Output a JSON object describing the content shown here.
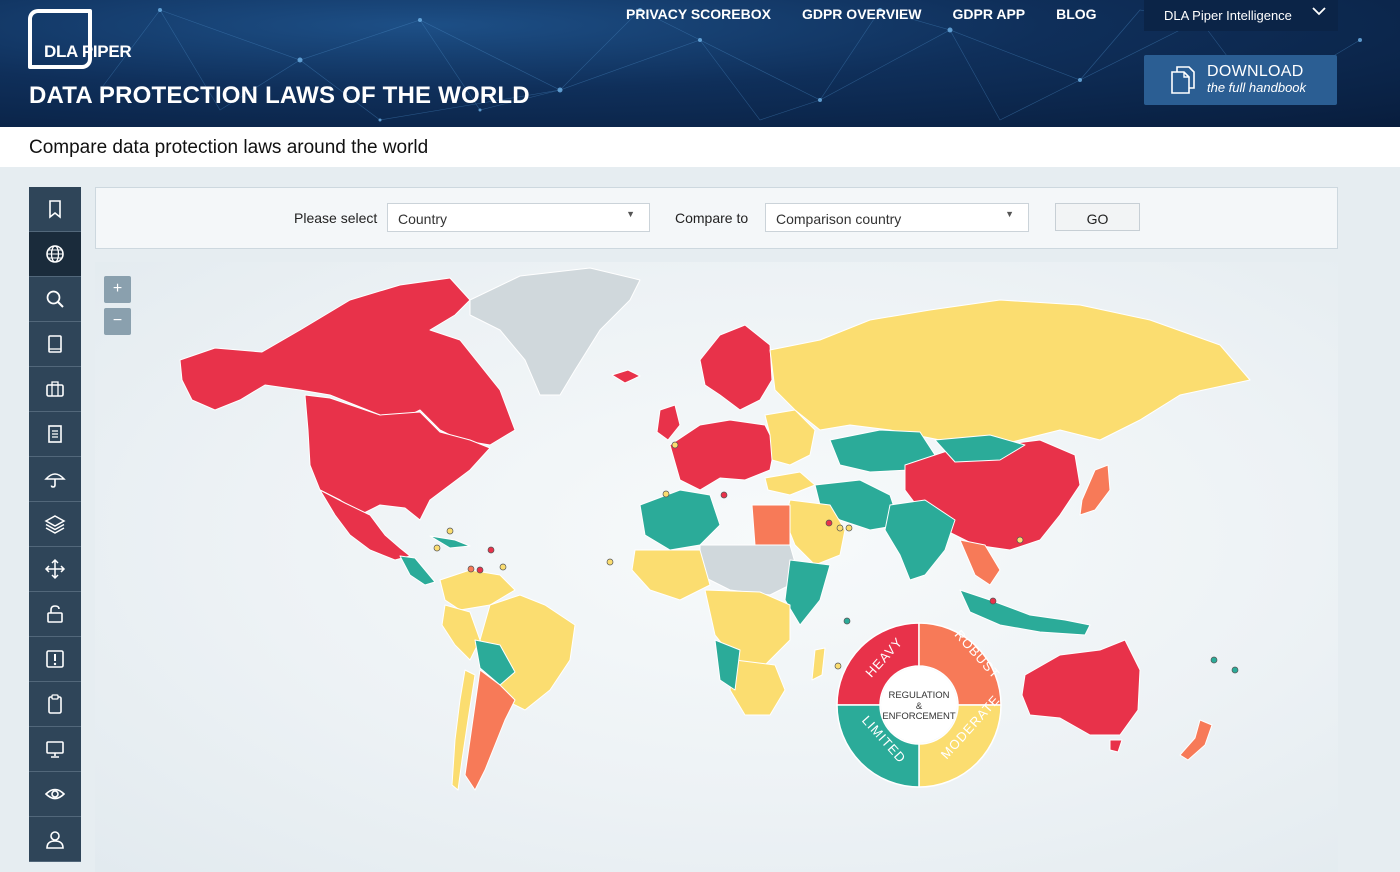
{
  "header": {
    "logo_text": "DLA PIPER",
    "site_title": "DATA PROTECTION LAWS OF THE WORLD",
    "nav": [
      "PRIVACY SCOREBOX",
      "GDPR OVERVIEW",
      "GDPR APP",
      "BLOG"
    ],
    "intelligence_label": "DLA Piper Intelligence",
    "download_main": "DOWNLOAD",
    "download_sub": "the full handbook"
  },
  "subtitle": "Compare data protection laws around the world",
  "sidebar": {
    "icons": [
      "bookmark-icon",
      "globe-icon",
      "search-icon",
      "book-icon",
      "briefcase-icon",
      "document-icon",
      "umbrella-icon",
      "layers-icon",
      "move-icon",
      "unlock-icon",
      "alert-icon",
      "clipboard-icon",
      "monitor-icon",
      "eye-icon",
      "user-icon"
    ],
    "active": "globe-icon"
  },
  "selector": {
    "select_label": "Please select",
    "country_placeholder": "Country",
    "compare_label": "Compare to",
    "comparison_placeholder": "Comparison country",
    "go_label": "GO"
  },
  "map": {
    "zoom_in": "+",
    "zoom_out": "−",
    "colors": {
      "heavy": "#e8324a",
      "robust": "#f77a58",
      "moderate": "#fbdd70",
      "limited": "#2bab99",
      "none": "#d0d8dc"
    }
  },
  "legend": {
    "heavy": "HEAVY",
    "robust": "ROBUST",
    "moderate": "MODERATE",
    "limited": "LIMITED",
    "center_line1": "REGULATION",
    "center_line2": "&",
    "center_line3": "ENFORCEMENT"
  }
}
